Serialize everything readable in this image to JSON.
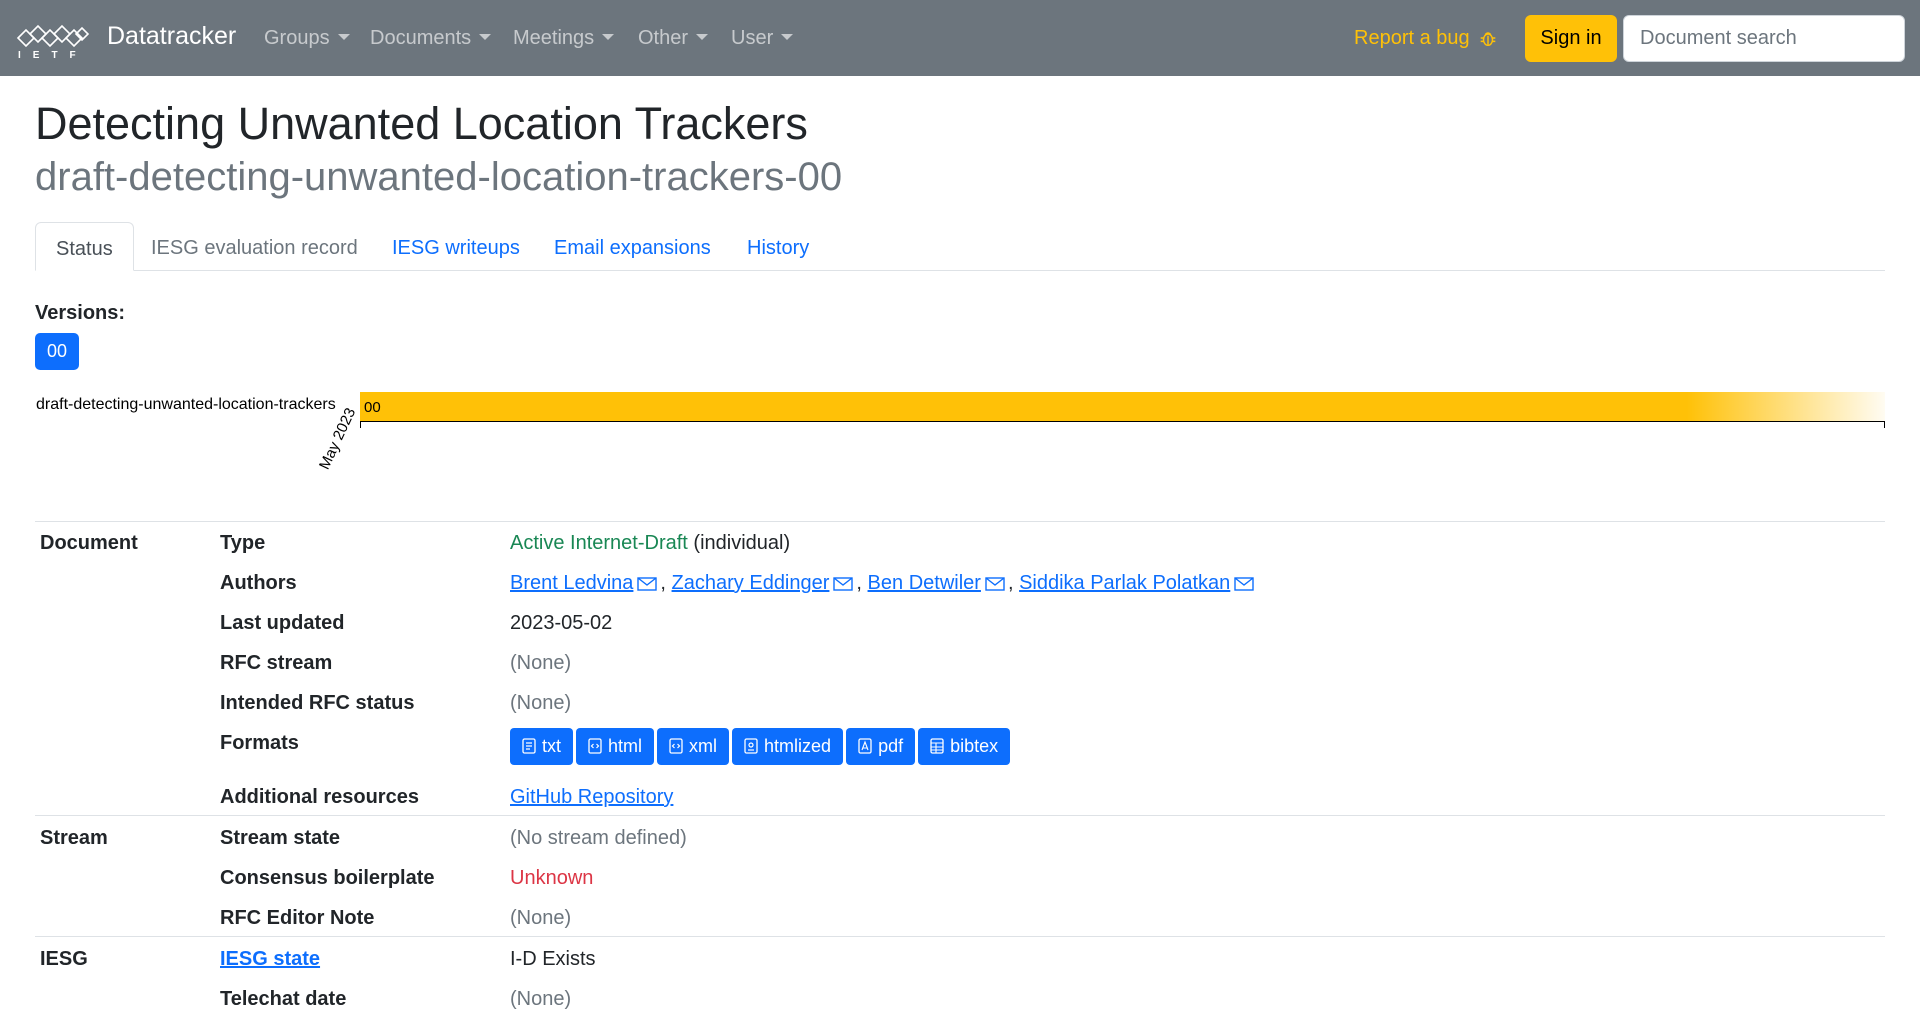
{
  "navbar": {
    "logo_text": "IETF",
    "brand": "Datatracker",
    "menus": [
      {
        "label": "Groups"
      },
      {
        "label": "Documents"
      },
      {
        "label": "Meetings"
      },
      {
        "label": "Other"
      },
      {
        "label": "User"
      }
    ],
    "report_bug": "Report a bug",
    "sign_in": "Sign in",
    "search_placeholder": "Document search"
  },
  "document": {
    "title": "Detecting Unwanted Location Trackers",
    "name": "draft-detecting-unwanted-location-trackers-00"
  },
  "tabs": [
    {
      "label": "Status",
      "state": "active"
    },
    {
      "label": "IESG evaluation record",
      "state": "disabled"
    },
    {
      "label": "IESG writeups",
      "state": "link"
    },
    {
      "label": "Email expansions",
      "state": "link"
    },
    {
      "label": "History",
      "state": "link"
    }
  ],
  "versions": {
    "label": "Versions:",
    "items": [
      "00"
    ]
  },
  "timeline": {
    "draft_name": "draft-detecting-unwanted-location-trackers",
    "bar_label": "00",
    "tick_label": "May 2023"
  },
  "info": {
    "document_section": "Document",
    "type_key": "Type",
    "type_value": "Active Internet-Draft",
    "type_suffix": "(individual)",
    "authors_key": "Authors",
    "authors": [
      "Brent Ledvina",
      "Zachary Eddinger",
      "Ben Detwiler",
      "Siddika Parlak Polatkan"
    ],
    "author_separator": ",",
    "last_updated_key": "Last updated",
    "last_updated_value": "2023-05-02",
    "rfc_stream_key": "RFC stream",
    "rfc_stream_value": "(None)",
    "intended_status_key": "Intended RFC status",
    "intended_status_value": "(None)",
    "formats_key": "Formats",
    "formats": [
      "txt",
      "html",
      "xml",
      "htmlized",
      "pdf",
      "bibtex"
    ],
    "additional_resources_key": "Additional resources",
    "github_link": "GitHub Repository",
    "stream_section": "Stream",
    "stream_state_key": "Stream state",
    "stream_state_value": "(No stream defined)",
    "consensus_key": "Consensus boilerplate",
    "consensus_value": "Unknown",
    "rfc_editor_note_key": "RFC Editor Note",
    "rfc_editor_note_value": "(None)",
    "iesg_section": "IESG",
    "iesg_state_key": "IESG state",
    "iesg_state_value": "I-D Exists",
    "telechat_key": "Telechat date",
    "telechat_value": "(None)"
  },
  "colors": {
    "navbar_bg": "#6c757d",
    "primary": "#0d6efd",
    "warning": "#ffc107",
    "success": "#198754",
    "danger": "#dc3545"
  }
}
